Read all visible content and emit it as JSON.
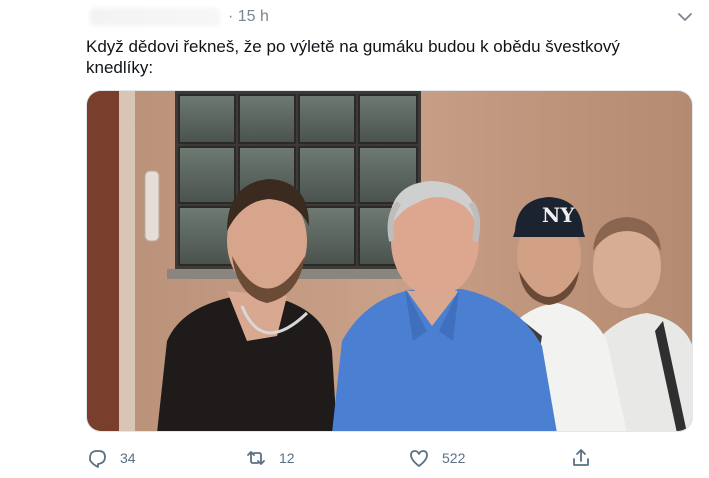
{
  "tweet": {
    "time_separator": "·",
    "time": "15 h",
    "text": "Když dědovi řekneš, že po výletě na gumáku budou k obědu švestkový knedlíky:"
  },
  "actions": {
    "reply_count": "34",
    "retweet_count": "12",
    "like_count": "522"
  },
  "icons": {
    "menu": "chevron-down-icon",
    "reply": "reply-icon",
    "retweet": "retweet-icon",
    "like": "heart-icon",
    "share": "share-icon"
  },
  "colors": {
    "muted": "#5b7083",
    "text": "#0f1419",
    "border": "#e1e8ed"
  }
}
